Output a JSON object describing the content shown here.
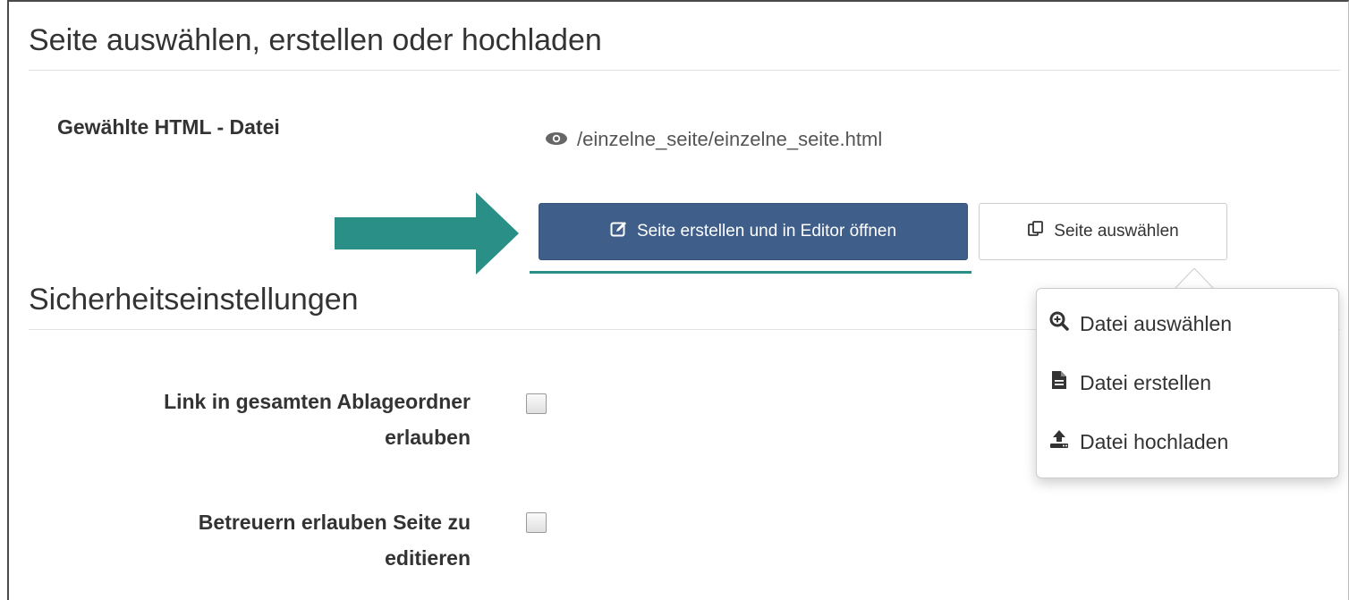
{
  "sections": {
    "page_select_title": "Seite auswählen, erstellen oder hochladen",
    "security_title": "Sicherheitseinstellungen"
  },
  "selected_file": {
    "label": "Gewählte HTML - Datei",
    "path": "/einzelne_seite/einzelne_seite.html",
    "icon": "eye-icon"
  },
  "actions": {
    "create_open_label": "Seite erstellen und in Editor öffnen",
    "select_label": "Seite auswählen"
  },
  "dropdown": {
    "items": [
      {
        "label": "Datei auswählen",
        "icon": "search-plus-icon"
      },
      {
        "label": "Datei erstellen",
        "icon": "file-icon"
      },
      {
        "label": "Datei hochladen",
        "icon": "upload-icon"
      }
    ]
  },
  "security": {
    "link_label_line1": "Link in gesamten Ablageordner",
    "link_label_line2": "erlauben",
    "link_checked": false,
    "editor_label_line1": "Betreuern erlauben Seite zu",
    "editor_label_line2": "editieren",
    "editor_checked": false
  },
  "colors": {
    "primary_button": "#3f5f8a",
    "annotation_teal": "#2a8f86"
  }
}
